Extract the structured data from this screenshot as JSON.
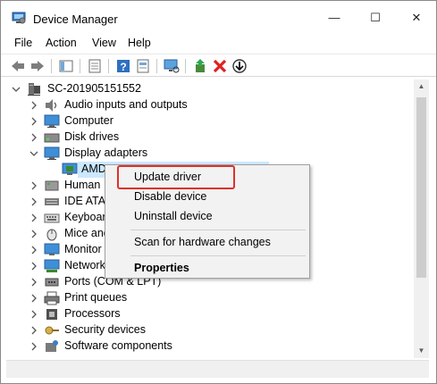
{
  "window": {
    "title": "Device Manager",
    "minimize": "—",
    "maximize": "☐",
    "close": "✕"
  },
  "menu": [
    "File",
    "Action",
    "View",
    "Help"
  ],
  "tree": {
    "root": "SC-201905151552",
    "items": [
      "Audio inputs and outputs",
      "Computer",
      "Disk drives",
      "Display adapters",
      "AMD",
      "Human",
      "IDE ATA/",
      "Keyboar",
      "Mice and",
      "Monitor",
      "Network",
      "Ports (COM & LPT)",
      "Print queues",
      "Processors",
      "Security devices",
      "Software components"
    ]
  },
  "context_menu": {
    "update_driver": "Update driver",
    "disable_device": "Disable device",
    "uninstall_device": "Uninstall device",
    "scan": "Scan for hardware changes",
    "properties": "Properties"
  },
  "colors": {
    "selection": "#cce8ff",
    "highlight_box": "#e0302a",
    "menu_bg": "#f2f2f2"
  }
}
